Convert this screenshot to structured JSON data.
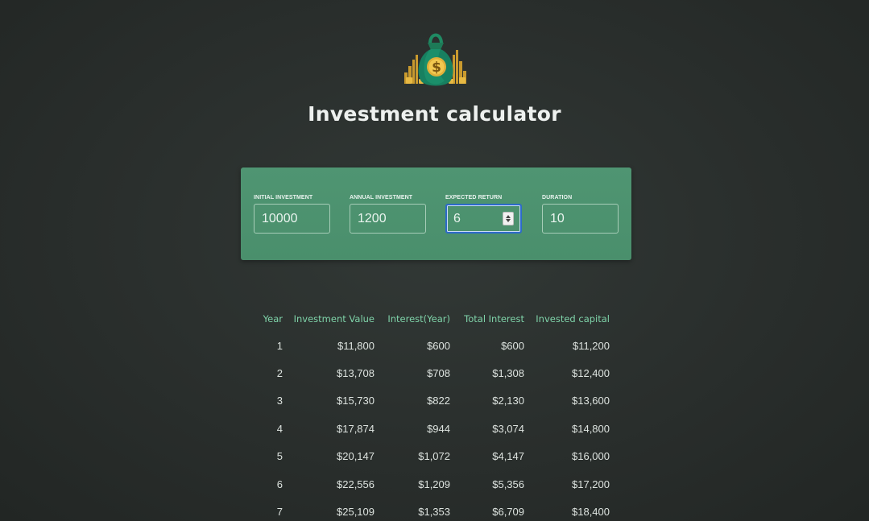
{
  "app": {
    "title": "Investment calculator",
    "logo_icon": "money-bag-icon"
  },
  "colors": {
    "panel": "#4f9572",
    "header_text": "#7fd3a9",
    "focus_ring": "#2d6ac9"
  },
  "inputs": {
    "initial_investment": {
      "label": "INITIAL INVESTMENT",
      "value": "10000"
    },
    "annual_investment": {
      "label": "ANNUAL INVESTMENT",
      "value": "1200"
    },
    "expected_return": {
      "label": "EXPECTED RETURN",
      "value": "6"
    },
    "duration": {
      "label": "DURATION",
      "value": "10"
    }
  },
  "table": {
    "headers": [
      "Year",
      "Investment Value",
      "Interest(Year)",
      "Total Interest",
      "Invested capital"
    ],
    "rows": [
      [
        "1",
        "$11,800",
        "$600",
        "$600",
        "$11,200"
      ],
      [
        "2",
        "$13,708",
        "$708",
        "$1,308",
        "$12,400"
      ],
      [
        "3",
        "$15,730",
        "$822",
        "$2,130",
        "$13,600"
      ],
      [
        "4",
        "$17,874",
        "$944",
        "$3,074",
        "$14,800"
      ],
      [
        "5",
        "$20,147",
        "$1,072",
        "$4,147",
        "$16,000"
      ],
      [
        "6",
        "$22,556",
        "$1,209",
        "$5,356",
        "$17,200"
      ],
      [
        "7",
        "$25,109",
        "$1,353",
        "$6,709",
        "$18,400"
      ]
    ]
  }
}
